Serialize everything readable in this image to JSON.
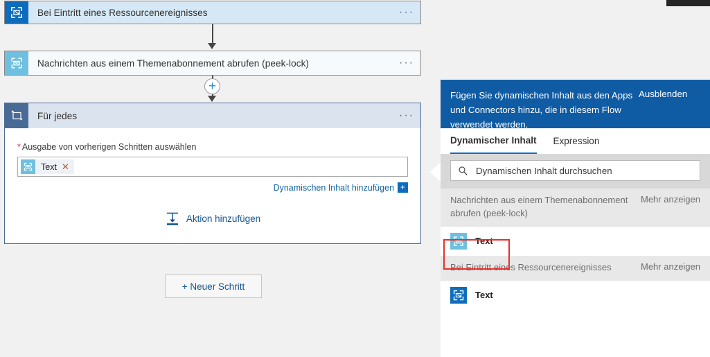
{
  "canvas": {
    "cards": [
      {
        "id": "trigger",
        "title": "Bei Eintritt eines Ressourcenereignisses",
        "icon": "resource-event-icon",
        "menu": "···"
      },
      {
        "id": "action",
        "title": "Nachrichten aus einem Themenabonnement abrufen (peek-lock)",
        "icon": "service-bus-message-icon",
        "menu": "···"
      },
      {
        "id": "foreach",
        "title": "Für jedes",
        "icon": "for-each-loop-icon",
        "menu": "···"
      }
    ],
    "plus_node_label": "+",
    "foreach": {
      "required_marker": "*",
      "field_label": "Ausgabe von vorherigen Schritten auswählen",
      "token": {
        "label": "Text",
        "remove": "✕",
        "icon": "service-bus-message-icon"
      },
      "dynamic_link": "Dynamischen Inhalt hinzufügen",
      "dynamic_plus": "+",
      "add_action": "Aktion hinzufügen",
      "add_action_icon": "insert-action-icon"
    },
    "new_step_button": "+ Neuer Schritt"
  },
  "flyout": {
    "header_text": "Fügen Sie dynamischen Inhalt aus den Apps und Connectors hinzu, die in diesem Flow verwendet werden.",
    "hide_label": "Ausblenden",
    "tabs": [
      {
        "label": "Dynamischer Inhalt",
        "active": true
      },
      {
        "label": "Expression",
        "active": false
      }
    ],
    "search": {
      "placeholder": "Dynamischen Inhalt durchsuchen",
      "icon": "search-icon"
    },
    "groups": [
      {
        "title": "Nachrichten aus einem Themenabonnement abrufen (peek-lock)",
        "more": "Mehr anzeigen",
        "items": [
          {
            "label": "Text",
            "icon": "service-bus-message-icon",
            "icon_color": "cyan",
            "highlighted": true
          }
        ]
      },
      {
        "title": "Bei Eintritt eines Ressourcenereignisses",
        "more": "Mehr anzeigen",
        "items": [
          {
            "label": "Text",
            "icon": "resource-event-icon",
            "icon_color": "blue",
            "highlighted": false
          }
        ]
      }
    ]
  },
  "colors": {
    "accent": "#0f6cbd",
    "header_blue": "#105ca4",
    "trigger_card_bg": "#d6e8f5",
    "action_card_bg": "#f7fafd",
    "foreach_header_bg": "#dbe3ee",
    "foreach_icon_bg": "#4a6a96",
    "cyan_icon": "#6fc0e0",
    "highlight_red": "#e8302a",
    "link_blue": "#14568f",
    "required_red": "#d13438"
  }
}
